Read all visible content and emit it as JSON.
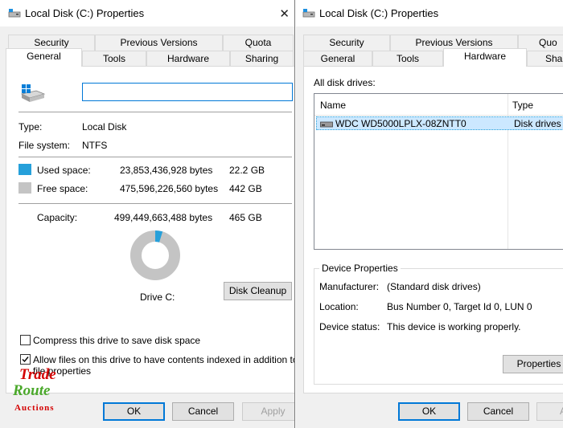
{
  "left_window": {
    "title": "Local Disk (C:) Properties",
    "tabs_back": [
      "Security",
      "Previous Versions",
      "Quota"
    ],
    "tabs_front": [
      "General",
      "Tools",
      "Hardware",
      "Sharing"
    ],
    "active_tab": "General",
    "general": {
      "volume_label_value": "",
      "type_label": "Type:",
      "type_value": "Local Disk",
      "fs_label": "File system:",
      "fs_value": "NTFS",
      "used_label": "Used space:",
      "used_bytes": "23,853,436,928 bytes",
      "used_size": "22.2 GB",
      "free_label": "Free space:",
      "free_bytes": "475,596,226,560 bytes",
      "free_size": "442 GB",
      "capacity_label": "Capacity:",
      "capacity_bytes": "499,449,663,488 bytes",
      "capacity_size": "465 GB",
      "drive_label": "Drive C:",
      "cleanup_button": "Disk Cleanup",
      "compress_label": "Compress this drive to save disk space",
      "compress_checked": false,
      "index_label_line1": "Allow files on this drive to have contents indexed in addition to",
      "index_label_line2": "file properties",
      "index_checked": true,
      "used_fraction": 0.0478,
      "used_color": "#26a0da",
      "free_color": "#c4c4c4"
    },
    "buttons": {
      "ok": "OK",
      "cancel": "Cancel",
      "apply": "Apply"
    }
  },
  "right_window": {
    "title": "Local Disk (C:) Properties",
    "tabs_back": [
      "Security",
      "Previous Versions",
      "Quo"
    ],
    "tabs_front": [
      "General",
      "Tools",
      "Hardware",
      "Sha"
    ],
    "active_tab": "Hardware",
    "hardware": {
      "all_drives_label": "All disk drives:",
      "col_name": "Name",
      "col_type": "Type",
      "rows": [
        {
          "name": "WDC WD5000LPLX-08ZNTT0",
          "type": "Disk drives"
        }
      ],
      "device_props_title": "Device Properties",
      "manufacturer_label": "Manufacturer:",
      "manufacturer_value": "(Standard disk drives)",
      "location_label": "Location:",
      "location_value": "Bus Number 0, Target Id 0, LUN 0",
      "status_label": "Device status:",
      "status_value": "This device is working properly.",
      "properties_button": "Properties"
    },
    "buttons": {
      "ok": "OK",
      "cancel": "Cancel",
      "apply": "A"
    }
  },
  "watermark": {
    "line1": "Trade",
    "line2": "Route",
    "line3": "Auctions"
  }
}
